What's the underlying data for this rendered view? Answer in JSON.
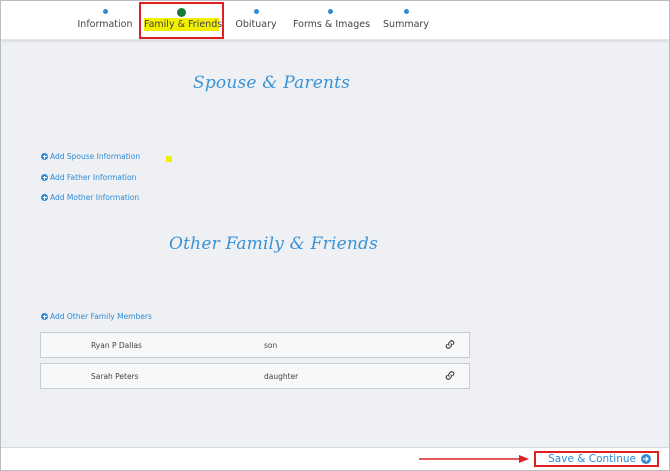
{
  "colors": {
    "accent_blue": "#2e8bd6",
    "highlight_yellow": "#f2f000",
    "active_dot": "#157a3a",
    "callout_red": "#e02020",
    "heading_blue": "#3a93d6"
  },
  "stepper": {
    "steps": [
      {
        "label": "Information"
      },
      {
        "label": "Family & Friends"
      },
      {
        "label": "Obituary"
      },
      {
        "label": "Forms & Images"
      },
      {
        "label": "Summary"
      }
    ]
  },
  "sections": {
    "spouse_parents": {
      "heading": "Spouse & Parents",
      "links": [
        {
          "label": "Add Spouse Information",
          "icon": "plus-circle-icon"
        },
        {
          "label": "Add Father Information",
          "icon": "plus-circle-icon"
        },
        {
          "label": "Add Mother Information",
          "icon": "plus-circle-icon"
        }
      ]
    },
    "other_family": {
      "heading": "Other Family & Friends",
      "add_link": {
        "label": "Add Other Family Members",
        "icon": "plus-circle-icon"
      },
      "members": [
        {
          "name": "Ryan P Dallas",
          "relation": "son",
          "icon": "link-icon"
        },
        {
          "name": "Sarah Peters",
          "relation": "daughter",
          "icon": "link-icon"
        }
      ]
    }
  },
  "footer": {
    "save_label": "Save & Continue",
    "save_icon": "arrow-right-circle-icon"
  }
}
